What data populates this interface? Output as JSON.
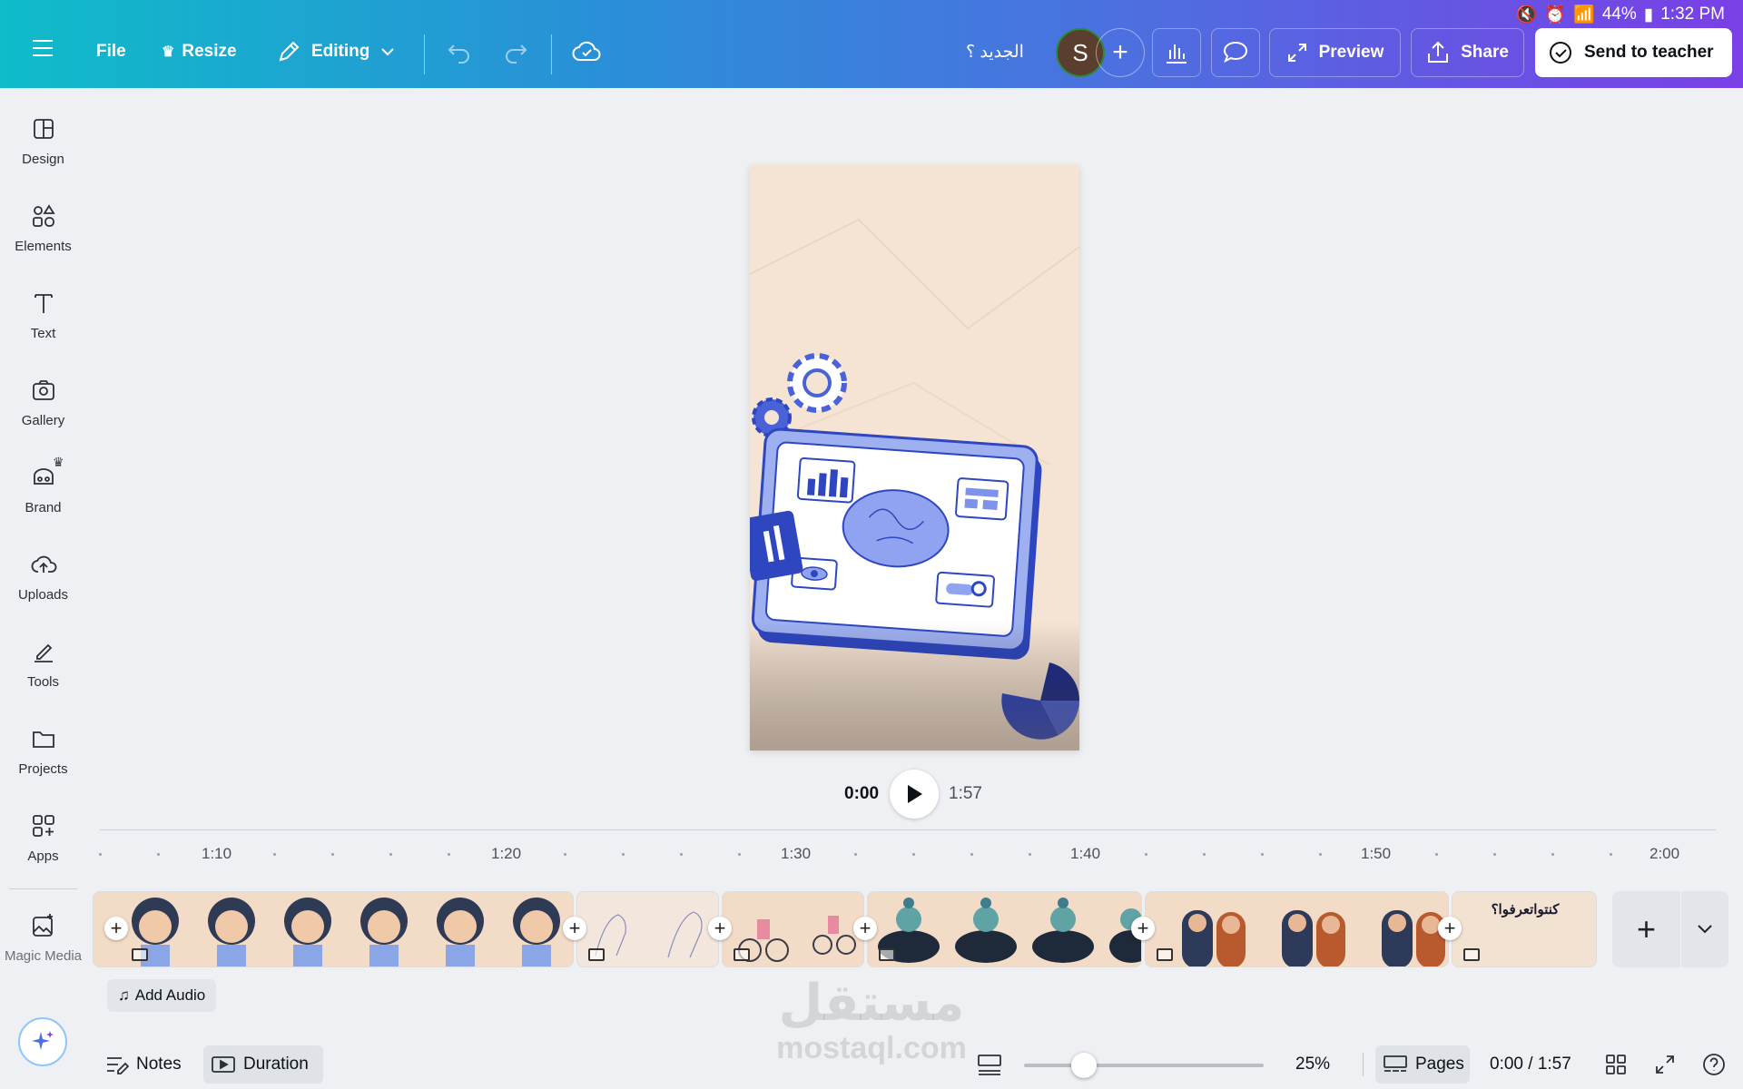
{
  "status_bar": {
    "battery": "44%",
    "time": "1:32 PM"
  },
  "topbar": {
    "file_label": "File",
    "resize_label": "Resize",
    "editing_label": "Editing",
    "doc_title": "الجديد ؟",
    "avatar_letter": "S",
    "preview_label": "Preview",
    "share_label": "Share",
    "send_label": "Send to teacher"
  },
  "sidebar": {
    "items": [
      {
        "label": "Design",
        "icon": "design-icon"
      },
      {
        "label": "Elements",
        "icon": "elements-icon"
      },
      {
        "label": "Text",
        "icon": "text-icon"
      },
      {
        "label": "Gallery",
        "icon": "camera-icon"
      },
      {
        "label": "Brand",
        "icon": "brand-icon"
      },
      {
        "label": "Uploads",
        "icon": "cloud-upload-icon"
      },
      {
        "label": "Tools",
        "icon": "pen-icon"
      },
      {
        "label": "Projects",
        "icon": "folder-icon"
      },
      {
        "label": "Apps",
        "icon": "apps-icon"
      }
    ],
    "magic_label": "Magic Media"
  },
  "playback": {
    "current": "0:00",
    "total": "1:57"
  },
  "ruler": {
    "ticks": [
      "1:10",
      "1:20",
      "1:30",
      "1:40",
      "1:50",
      "2:00"
    ]
  },
  "timeline": {
    "clips": [
      {
        "name": "clip-girl-sad"
      },
      {
        "name": "clip-sketch"
      },
      {
        "name": "clip-bikes"
      },
      {
        "name": "clip-meditate"
      },
      {
        "name": "clip-two-women"
      },
      {
        "name": "clip-arabic-text",
        "text": "كنتواتعرفوا؟"
      }
    ],
    "add_audio_label": "Add Audio"
  },
  "bottom_bar": {
    "notes_label": "Notes",
    "duration_label": "Duration",
    "zoom_value": "25%",
    "zoom_fraction": 0.25,
    "pages_label": "Pages",
    "time_readout": "0:00 / 1:57"
  },
  "watermark": {
    "text_ar": "مستقل",
    "text_en": "mostaql.com"
  },
  "colors": {
    "accent": "#7a3fe6",
    "brand_start": "#0fbcc9",
    "illustration_blue": "#5b73e0"
  }
}
